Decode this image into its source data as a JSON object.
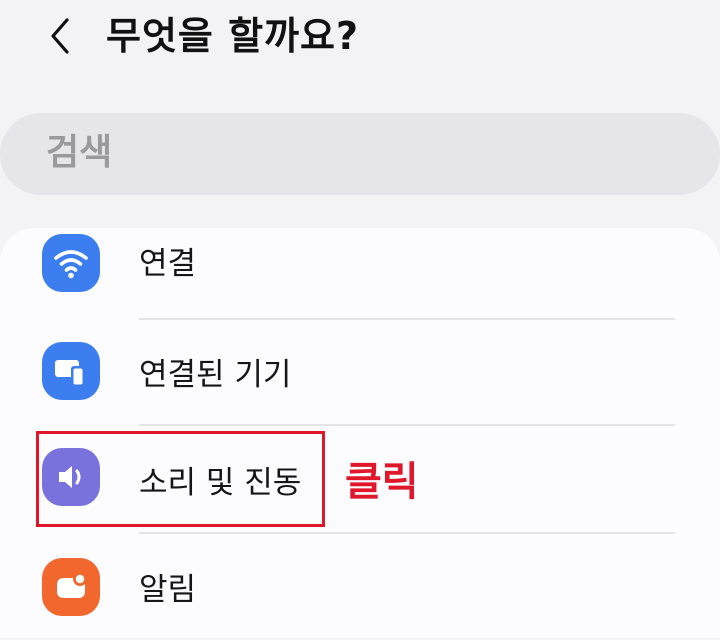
{
  "header": {
    "back_icon": "chevron-left-icon",
    "title": "무엇을 할까요?"
  },
  "search": {
    "placeholder": "검색"
  },
  "menu": {
    "items": [
      {
        "label": "연결",
        "icon": "wifi-icon",
        "icon_color": "#3c7ef0"
      },
      {
        "label": "연결된 기기",
        "icon": "connected-devices-icon",
        "icon_color": "#3c7ef0"
      },
      {
        "label": "소리 및 진동",
        "icon": "speaker-icon",
        "icon_color": "#7a72dc"
      },
      {
        "label": "알림",
        "icon": "notification-icon",
        "icon_color": "#f2672d"
      }
    ]
  },
  "annotation": {
    "text": "클릭",
    "color": "#e0162b"
  }
}
